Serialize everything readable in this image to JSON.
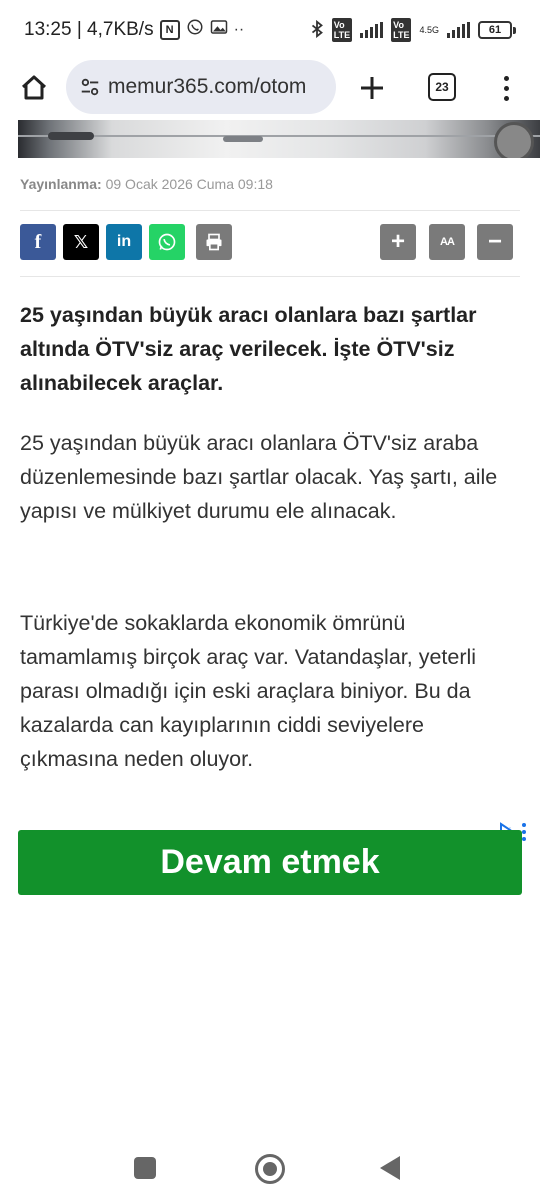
{
  "status_bar": {
    "time_speed": "13:25 | 4,7KB/s",
    "lte_label": "4.5G",
    "battery": "61"
  },
  "browser": {
    "url": "memur365.com/otom",
    "tab_count": "23"
  },
  "article": {
    "published_label": "Yayınlanma:",
    "published_date": "09 Ocak 2026 Cuma 09:18",
    "lead": "25 yaşından büyük aracı olanlara bazı şartlar altında ÖTV'siz araç verilecek. İşte ÖTV'siz alınabilecek araçlar.",
    "paragraphs": [
      "25 yaşından büyük aracı olanlara ÖTV'siz araba düzenlemesinde bazı şartlar olacak. Yaş şartı, aile yapısı ve mülkiyet durumu ele alınacak.",
      "Türkiye'de sokaklarda ekonomik ömrünü tamamlamış birçok araç var. Vatandaşlar, yeterli parası olmadığı için eski araçlara biniyor. Bu da kazalarda can kayıplarının ciddi seviyelere çıkmasına neden oluyor."
    ]
  },
  "share": {
    "facebook": "f",
    "x": "𝕏",
    "linkedin": "in",
    "font_size": "AA",
    "zoom_in": "+",
    "zoom_out": "−"
  },
  "ad": {
    "button_label": "Devam etmek"
  },
  "colors": {
    "facebook": "#3b5998",
    "linkedin": "#0e76a8",
    "whatsapp": "#25d366",
    "ad_green": "#12912b"
  }
}
